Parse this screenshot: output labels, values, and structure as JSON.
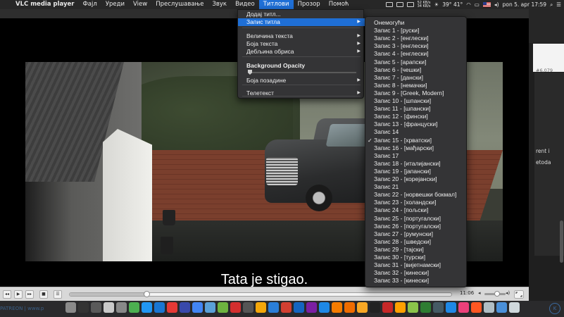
{
  "menubar": {
    "app_name": "VLC media player",
    "items": [
      "Фајл",
      "Уреди",
      "View",
      "Преслушавање",
      "Звук",
      "Видео",
      "Титлови",
      "Прозор",
      "Помоћ"
    ],
    "active_item": "Титлови",
    "status": {
      "net_up": "52 KB/s",
      "net_down": "34 KB/s",
      "temperature": "39° 41°",
      "datetime": "pon 5. apr  17:59"
    }
  },
  "subtitles_menu": {
    "items": [
      {
        "label": "Додај титл...",
        "has_submenu": false
      },
      {
        "label": "Запис титла",
        "has_submenu": true,
        "highlighted": true
      },
      {
        "label": "Величина текста",
        "has_submenu": true
      },
      {
        "label": "Боја текста",
        "has_submenu": true
      },
      {
        "label": "Дебљина обриса",
        "has_submenu": true
      },
      {
        "label": "Background Opacity",
        "has_submenu": false,
        "bold": true
      },
      {
        "label": "Боја позадине",
        "has_submenu": true
      },
      {
        "label": "Телетекст",
        "has_submenu": true
      }
    ],
    "background_opacity": 0.0
  },
  "track_submenu": {
    "items": [
      "Онемогући",
      "Запис 1 - [руски]",
      "Запис 2 - [енглески]",
      "Запис 3 - [енглески]",
      "Запис 4 - [енглески]",
      "Запис 5 - [арапски]",
      "Запис 6 - [чешки]",
      "Запис 7 - [дански]",
      "Запис 8 - [немачки]",
      "Запис 9 - [Greek, Modern]",
      "Запис 10 - [шпански]",
      "Запис 11 - [шпански]",
      "Запис 12 - [фински]",
      "Запис 13 - [француски]",
      "Запис 14",
      "Запис 15 - [хрватски]",
      "Запис 16 - [мађарски]",
      "Запис 17",
      "Запис 18 - [италијански]",
      "Запис 19 - [јапански]",
      "Запис 20 - [корејански]",
      "Запис 21",
      "Запис 22 - [норвешки бокмал]",
      "Запис 23 - [холандски]",
      "Запис 24 - [пољски]",
      "Запис 25 - [португалски]",
      "Запис 26 - [португалски]",
      "Запис 27 - [румунски]",
      "Запис 28 - [шведски]",
      "Запис 29 - [тајски]",
      "Запис 30 - [турски]",
      "Запис 31 - [вијетнамски]",
      "Запис 32 - [кинески]",
      "Запис 33 - [кинески]"
    ],
    "checked_index": 15
  },
  "player": {
    "subtitle_text": "Tata je stigao.",
    "time": "11:06",
    "progress_fraction": 0.2,
    "volume_fraction": 0.6,
    "buttons": {
      "rewind": "◂◂",
      "play": "▶",
      "forward": "▸▸",
      "stop": "■",
      "playlist": "☰"
    }
  },
  "right_window": {
    "id_text": "#6,079",
    "text_1": "rent i",
    "text_2": "etoda"
  },
  "dock": {
    "left_text": "PATREON | www.p",
    "icon_colors": [
      "#8a8a8a",
      "#333",
      "#5a5a5a",
      "#c9c9c9",
      "#888",
      "#4caf50",
      "#2196f3",
      "#1976d2",
      "#e53935",
      "#3949ab",
      "#4285f4",
      "#5aa0d8",
      "#6db33f",
      "#d32f2f",
      "#555",
      "#f4a70a",
      "#2a7ed8",
      "#d23f31",
      "#1565c0",
      "#7b1fa2",
      "#1e88e5",
      "#f57c00",
      "#ef6c00",
      "#f9a825",
      "#222",
      "#c62828",
      "#ffa000",
      "#8bc34a",
      "#2e7d32",
      "#455a64",
      "#1e88e5",
      "#ec407a",
      "#ff5722",
      "#b0bec5",
      "#4a90d9",
      "#cfd8dc"
    ],
    "right_icon": "K"
  }
}
